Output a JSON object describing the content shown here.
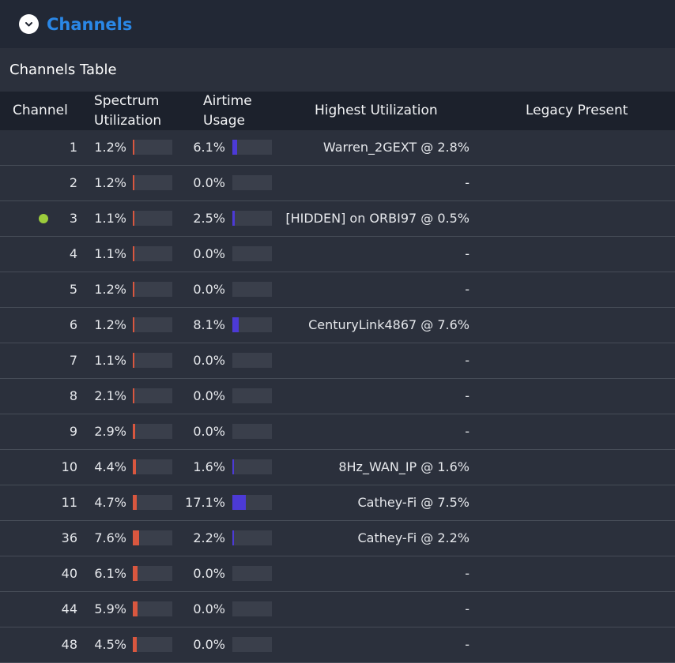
{
  "header": {
    "section_title": "Channels",
    "collapse_icon": "chevron-down-icon"
  },
  "table": {
    "title": "Channels Table",
    "columns": {
      "channel": "Channel",
      "spectrum_line1": "Spectrum",
      "spectrum_line2": "Utilization",
      "airtime_line1": "Airtime",
      "airtime_line2": "Usage",
      "highest": "Highest Utilization",
      "legacy": "Legacy Present"
    },
    "colors": {
      "spectrum_bar": "#d9573f",
      "airtime_bar": "#4c3ad6",
      "active_dot": "#9ccc3c",
      "title_accent": "#2a87e6"
    },
    "rows": [
      {
        "channel": "1",
        "spectrum": "1.2%",
        "airtime": "6.1%",
        "highest": "Warren_2GEXT @ 2.8%",
        "legacy": "",
        "active": false
      },
      {
        "channel": "2",
        "spectrum": "1.2%",
        "airtime": "0.0%",
        "highest": "-",
        "legacy": "",
        "active": false
      },
      {
        "channel": "3",
        "spectrum": "1.1%",
        "airtime": "2.5%",
        "highest": "[HIDDEN] on ORBI97 @ 0.5%",
        "legacy": "",
        "active": true
      },
      {
        "channel": "4",
        "spectrum": "1.1%",
        "airtime": "0.0%",
        "highest": "-",
        "legacy": "",
        "active": false
      },
      {
        "channel": "5",
        "spectrum": "1.2%",
        "airtime": "0.0%",
        "highest": "-",
        "legacy": "",
        "active": false
      },
      {
        "channel": "6",
        "spectrum": "1.2%",
        "airtime": "8.1%",
        "highest": "CenturyLink4867 @ 7.6%",
        "legacy": "",
        "active": false
      },
      {
        "channel": "7",
        "spectrum": "1.1%",
        "airtime": "0.0%",
        "highest": "-",
        "legacy": "",
        "active": false
      },
      {
        "channel": "8",
        "spectrum": "2.1%",
        "airtime": "0.0%",
        "highest": "-",
        "legacy": "",
        "active": false
      },
      {
        "channel": "9",
        "spectrum": "2.9%",
        "airtime": "0.0%",
        "highest": "-",
        "legacy": "",
        "active": false
      },
      {
        "channel": "10",
        "spectrum": "4.4%",
        "airtime": "1.6%",
        "highest": "8Hz_WAN_IP @ 1.6%",
        "legacy": "",
        "active": false
      },
      {
        "channel": "11",
        "spectrum": "4.7%",
        "airtime": "17.1%",
        "highest": "Cathey-Fi @ 7.5%",
        "legacy": "",
        "active": false
      },
      {
        "channel": "36",
        "spectrum": "7.6%",
        "airtime": "2.2%",
        "highest": "Cathey-Fi @ 2.2%",
        "legacy": "",
        "active": false
      },
      {
        "channel": "40",
        "spectrum": "6.1%",
        "airtime": "0.0%",
        "highest": "-",
        "legacy": "",
        "active": false
      },
      {
        "channel": "44",
        "spectrum": "5.9%",
        "airtime": "0.0%",
        "highest": "-",
        "legacy": "",
        "active": false
      },
      {
        "channel": "48",
        "spectrum": "4.5%",
        "airtime": "0.0%",
        "highest": "-",
        "legacy": "",
        "active": false
      }
    ]
  }
}
